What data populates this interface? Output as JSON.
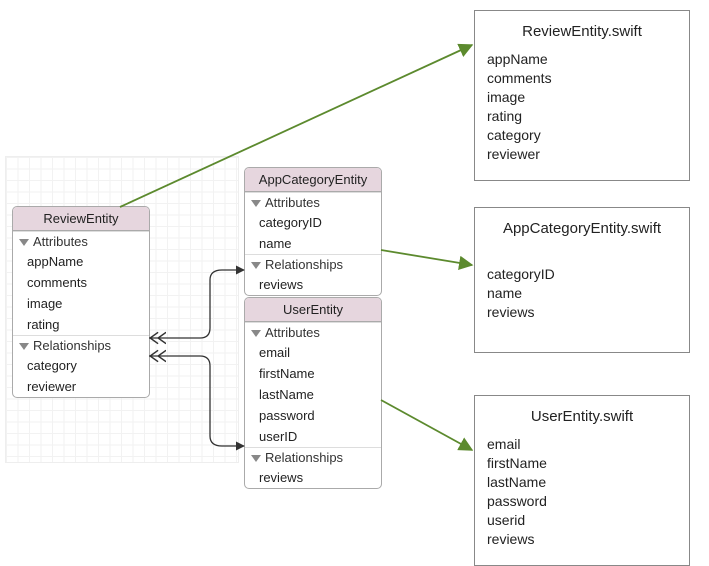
{
  "entities": {
    "review": {
      "title": "ReviewEntity",
      "sections": {
        "attrs_label": "Attributes",
        "attrs": [
          "appName",
          "comments",
          "image",
          "rating"
        ],
        "rels_label": "Relationships",
        "rels": [
          "category",
          "reviewer"
        ]
      }
    },
    "appCategory": {
      "title": "AppCategoryEntity",
      "sections": {
        "attrs_label": "Attributes",
        "attrs": [
          "categoryID",
          "name"
        ],
        "rels_label": "Relationships",
        "rels": [
          "reviews"
        ]
      }
    },
    "user": {
      "title": "UserEntity",
      "sections": {
        "attrs_label": "Attributes",
        "attrs": [
          "email",
          "firstName",
          "lastName",
          "password",
          "userID"
        ],
        "rels_label": "Relationships",
        "rels": [
          "reviews"
        ]
      }
    }
  },
  "swift": {
    "review": {
      "title": "ReviewEntity.swift",
      "lines": [
        "appName",
        "comments",
        "image",
        "rating",
        "category",
        "reviewer"
      ]
    },
    "appCategory": {
      "title": "AppCategoryEntity.swift",
      "lines": [
        "categoryID",
        "name",
        "reviews"
      ]
    },
    "user": {
      "title": "UserEntity.swift",
      "lines": [
        "email",
        "firstName",
        "lastName",
        "password",
        "userid",
        "reviews"
      ]
    }
  },
  "chart_data": {
    "type": "table",
    "entities": [
      {
        "name": "ReviewEntity",
        "attributes": [
          "appName",
          "comments",
          "image",
          "rating"
        ],
        "relationships": [
          "category",
          "reviewer"
        ]
      },
      {
        "name": "AppCategoryEntity",
        "attributes": [
          "categoryID",
          "name"
        ],
        "relationships": [
          "reviews"
        ]
      },
      {
        "name": "UserEntity",
        "attributes": [
          "email",
          "firstName",
          "lastName",
          "password",
          "userID"
        ],
        "relationships": [
          "reviews"
        ]
      }
    ],
    "links": [
      {
        "from": "ReviewEntity.category",
        "to": "AppCategoryEntity.reviews",
        "kind": "to-many-inverse"
      },
      {
        "from": "ReviewEntity.reviewer",
        "to": "UserEntity.reviews",
        "kind": "to-many-inverse"
      }
    ],
    "generated_files": [
      "ReviewEntity.swift",
      "AppCategoryEntity.swift",
      "UserEntity.swift"
    ]
  }
}
